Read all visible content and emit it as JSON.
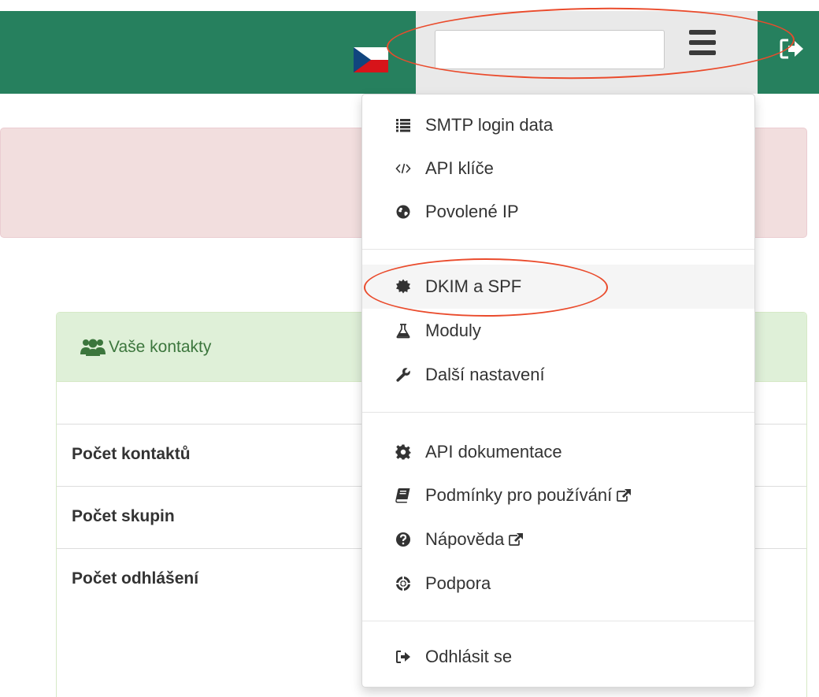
{
  "header": {
    "flag_icon": "czech-flag-icon",
    "search": {
      "value": "",
      "placeholder": ""
    },
    "menu_icon": "hamburger-icon",
    "logout_icon": "sign-out-icon"
  },
  "panel": {
    "title": "Vaše kontakty",
    "rows": [
      {
        "label": "Počet kontaktů"
      },
      {
        "label": "Počet skupin"
      },
      {
        "label": "Počet odhlášení"
      }
    ]
  },
  "menu": {
    "groups": [
      [
        {
          "label": "SMTP login data",
          "icon": "list-icon"
        },
        {
          "label": "API klíče",
          "icon": "code-icon"
        },
        {
          "label": "Povolené IP",
          "icon": "globe-icon"
        }
      ],
      [
        {
          "label": "DKIM a SPF",
          "icon": "certificate-icon"
        },
        {
          "label": "Moduly",
          "icon": "flask-icon"
        },
        {
          "label": "Další nastavení",
          "icon": "wrench-icon"
        }
      ],
      [
        {
          "label": "API dokumentace",
          "icon": "cog-icon"
        },
        {
          "label": "Podmínky pro používání",
          "icon": "book-icon",
          "external": true
        },
        {
          "label": "Nápověda",
          "icon": "question-circle-icon",
          "external": true
        },
        {
          "label": "Podpora",
          "icon": "life-ring-icon"
        }
      ],
      [
        {
          "label": "Odhlásit se",
          "icon": "sign-out-icon"
        }
      ]
    ]
  },
  "colors": {
    "topbar": "#26805e",
    "menu_zone": "#e9e9e9",
    "alert_bg": "#f2dede",
    "panel_heading_bg": "#dff0d8",
    "panel_heading_text": "#3c763d",
    "annotation": "#ea4b2c"
  }
}
